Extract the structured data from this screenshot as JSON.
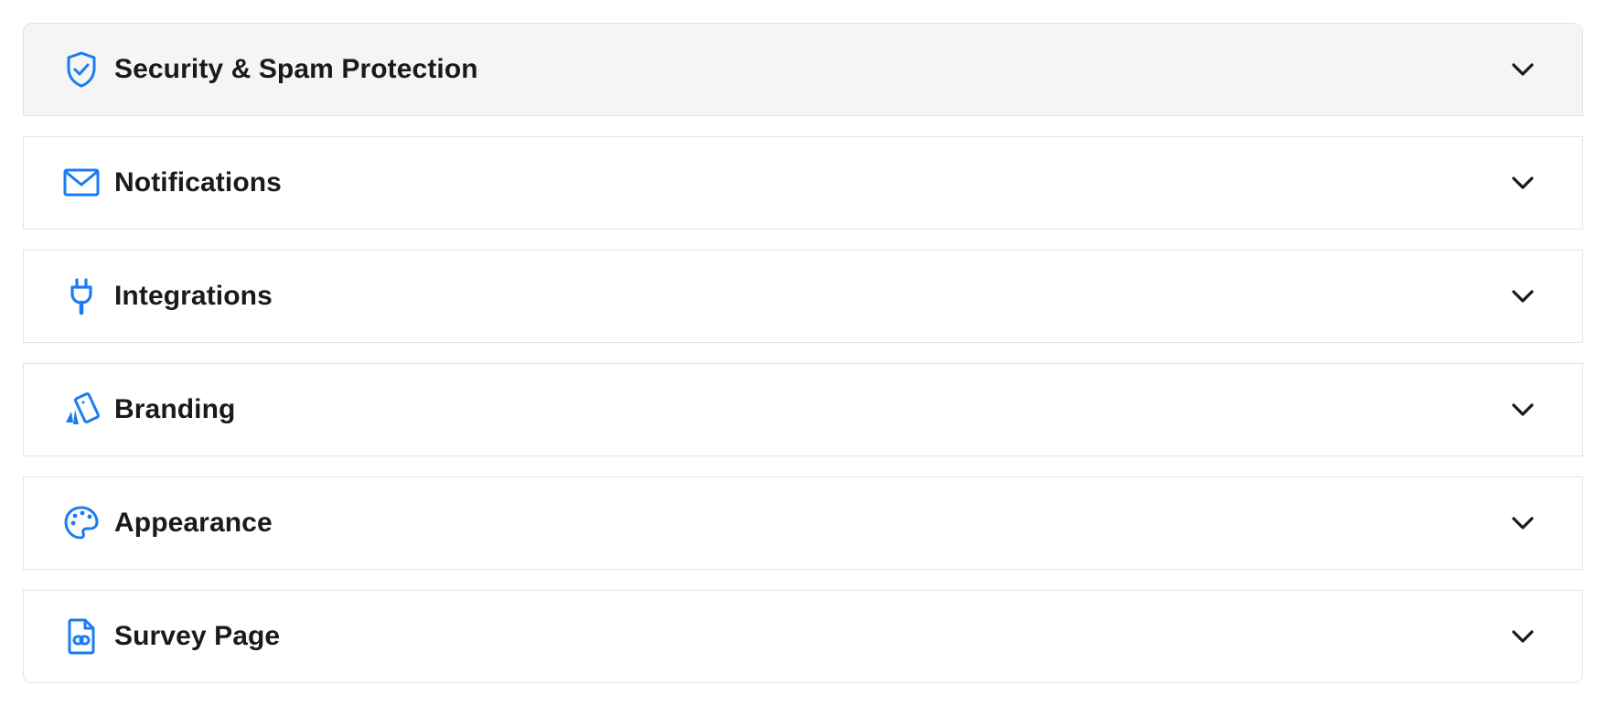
{
  "colors": {
    "accent": "#1a7cf2",
    "text": "#1a1a1a",
    "hover_bg": "#f5f5f5",
    "border": "#e4e4e4"
  },
  "sections": [
    {
      "label": "Security & Spam Protection",
      "icon": "shield-check-icon",
      "expanded": false
    },
    {
      "label": "Notifications",
      "icon": "envelope-icon",
      "expanded": false
    },
    {
      "label": "Integrations",
      "icon": "plug-icon",
      "expanded": false
    },
    {
      "label": "Branding",
      "icon": "swatch-cards-icon",
      "expanded": false
    },
    {
      "label": "Appearance",
      "icon": "palette-icon",
      "expanded": false
    },
    {
      "label": "Survey Page",
      "icon": "file-link-icon",
      "expanded": false
    }
  ]
}
